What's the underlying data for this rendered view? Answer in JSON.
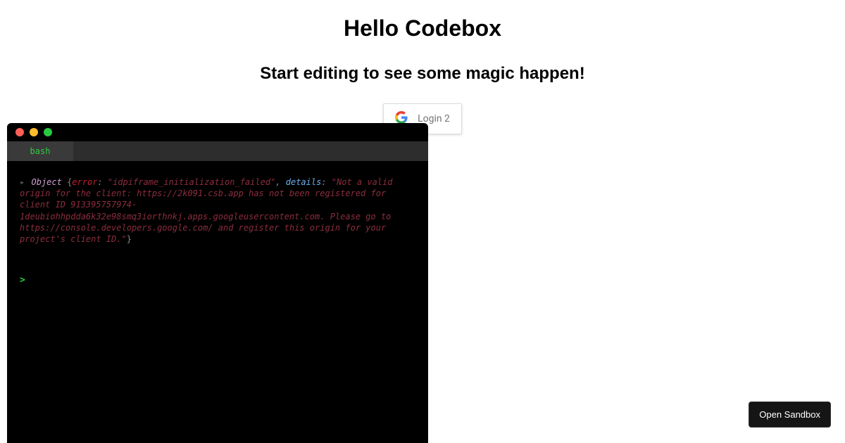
{
  "header": {
    "title": "Hello Codebox",
    "subtitle": "Start editing to see some magic happen!"
  },
  "login": {
    "label": "Login 2"
  },
  "terminal": {
    "tab_label": "bash",
    "output": {
      "object_kw": "Object",
      "error_key": "error",
      "error_val": "\"idpiframe_initialization_failed\"",
      "details_key": "details",
      "details_val": "\"Not a valid origin for the client: https://2k091.csb.app has not been registered for client ID 913395757974-1deubiohhpdda6k32e98smq3iorthnkj.apps.googleusercontent.com. Please go to https://console.developers.google.com/ and register this origin for your project's client ID.\""
    },
    "prompt": ">"
  },
  "sandbox_button": {
    "label": "Open Sandbox"
  }
}
